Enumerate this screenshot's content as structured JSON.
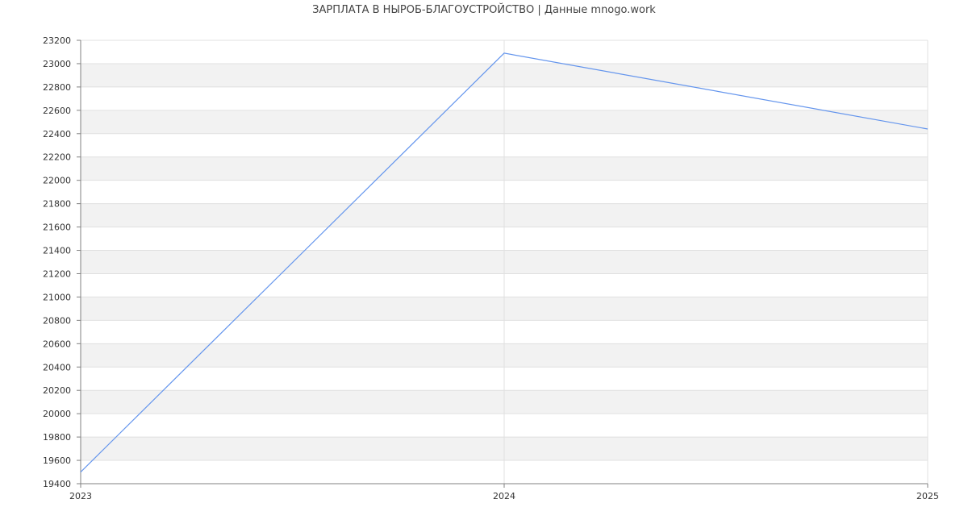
{
  "chart_data": {
    "type": "line",
    "title": "ЗАРПЛАТА В НЫРОБ-БЛАГОУСТРОЙСТВО | Данные mnogo.work",
    "xlabel": "",
    "ylabel": "",
    "x": [
      "2023",
      "2024",
      "2025"
    ],
    "series": [
      {
        "values": [
          19500,
          23090,
          22440
        ]
      }
    ],
    "ylim": [
      19400,
      23200
    ],
    "ytick_step": 200,
    "grid": true,
    "legend": "none",
    "colors": {
      "line": "#6495ed",
      "band": "#f2f2f2",
      "gridline": "#e0e0e0",
      "axis": "#808080"
    }
  }
}
